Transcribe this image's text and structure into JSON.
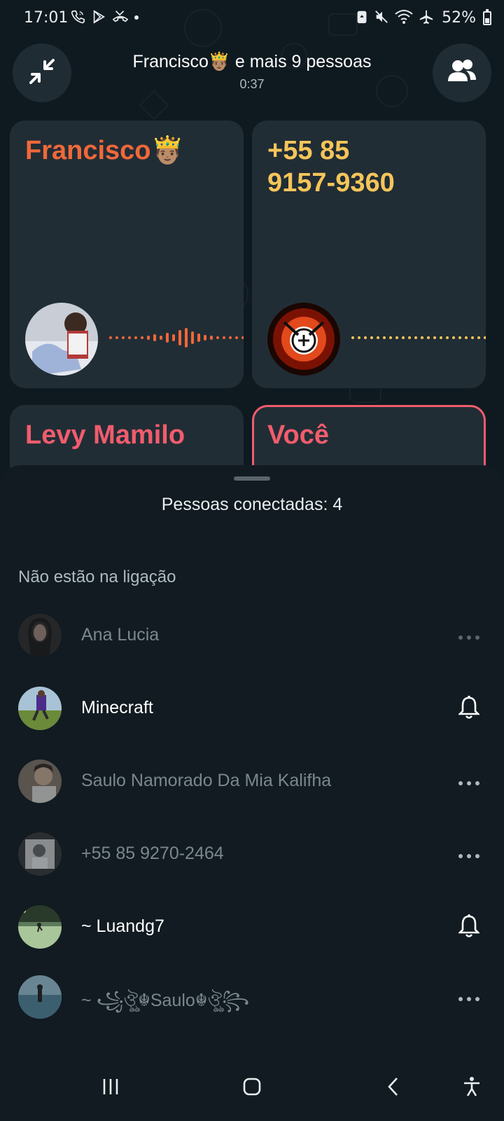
{
  "status_bar": {
    "time": "17:01",
    "battery": "52%",
    "icons_left": [
      "phone-call-icon",
      "play-store-icon",
      "missed-call-icon",
      "dot-icon"
    ],
    "icons_right": [
      "battery-saver-icon",
      "mute-icon",
      "wifi-icon",
      "airplane-icon"
    ]
  },
  "header": {
    "title": "Francisco🤴🏽 e mais 9 pessoas",
    "duration": "0:37",
    "minimize_icon": "minimize-icon",
    "participants_icon": "group-icon"
  },
  "tiles": [
    {
      "name": "Francisco🤴🏽",
      "color": "#f0683a",
      "speaking": true
    },
    {
      "name": "+55 85\n9157-9360",
      "color": "#f5c55a",
      "speaking": false
    },
    {
      "name": "Levy Mamilo",
      "color": "#f15c6d"
    },
    {
      "name": "Você",
      "color": "#f15c6d",
      "active": true
    }
  ],
  "sheet": {
    "connected": "Pessoas conectadas: 4",
    "section_label": "Não estão na ligação",
    "people": [
      {
        "name": "Ana Lucia",
        "state": "dim",
        "action": "more-icon"
      },
      {
        "name": "Minecraft",
        "state": "bright",
        "action": "bell-icon"
      },
      {
        "name": "Saulo Namorado Da Mia Kalifha",
        "state": "dim",
        "action": "more-icon"
      },
      {
        "name": "+55 85 9270-2464",
        "state": "dim",
        "action": "more-icon"
      },
      {
        "name": "~ Luandg7",
        "state": "bright",
        "action": "bell-icon"
      },
      {
        "name": "~ ꧁ঔৣ☬Saulo☬ঔৣ꧂",
        "state": "dim",
        "action": "more-icon"
      }
    ]
  },
  "navbar": [
    "recents-icon",
    "home-icon",
    "back-icon",
    "accessibility-icon"
  ]
}
